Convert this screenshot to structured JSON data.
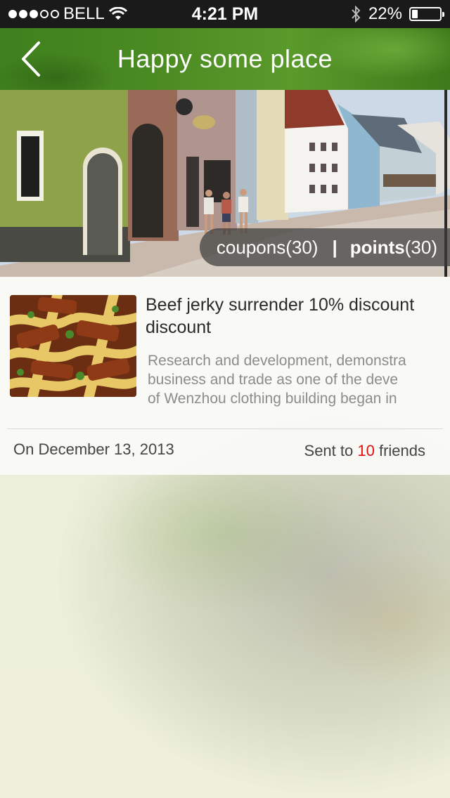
{
  "status_bar": {
    "carrier": "BELL",
    "time": "4:21 PM",
    "battery_percent": "22%",
    "battery_level": 0.22,
    "signal_filled": 3,
    "signal_total": 5,
    "icons": [
      "wifi-icon",
      "bluetooth-icon",
      "battery-icon"
    ]
  },
  "nav": {
    "title": "Happy some place",
    "back_icon": "chevron-left-icon"
  },
  "hero": {
    "coupons_label": "coupons",
    "coupons_count": "(30)",
    "divider": "|",
    "points_label": "points",
    "points_count": "(30)"
  },
  "item": {
    "title": "Beef jerky surrender 10% discount discount",
    "description_lines": [
      "Research and development, demonstra",
      "business and trade as one of the deve",
      "of Wenzhou clothing building began in"
    ],
    "date": "On December 13, 2013",
    "sent_prefix": "Sent to ",
    "sent_count": "10",
    "sent_suffix": " friends"
  },
  "colors": {
    "nav_green": "#4b8b22",
    "accent_red": "#e01010",
    "status_bar_bg": "#1a1a1a"
  }
}
